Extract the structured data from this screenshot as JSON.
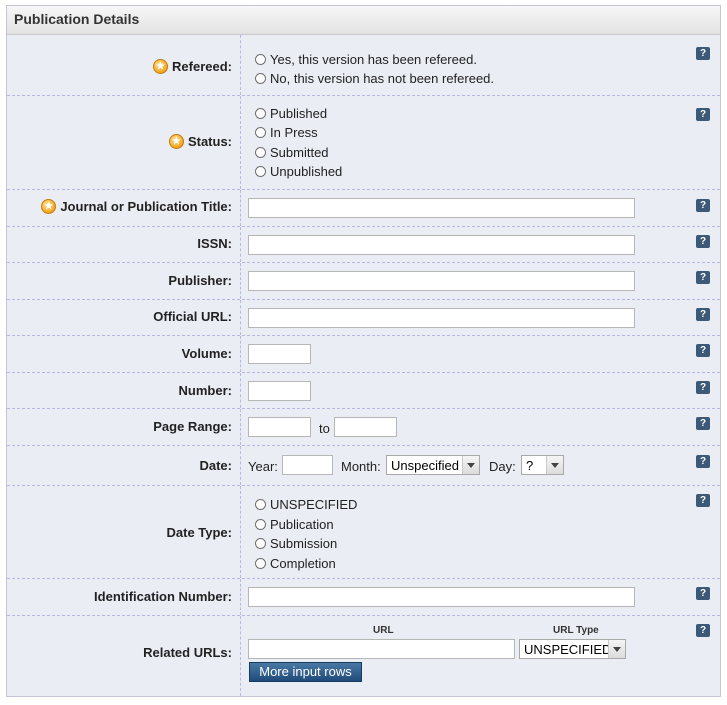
{
  "panel": {
    "title": "Publication Details",
    "help_glyph": "?"
  },
  "refereed": {
    "label": "Refereed:",
    "options": [
      "Yes, this version has been refereed.",
      "No, this version has not been refereed."
    ]
  },
  "status": {
    "label": "Status:",
    "options": [
      "Published",
      "In Press",
      "Submitted",
      "Unpublished"
    ]
  },
  "journal_title": {
    "label": "Journal or Publication Title:",
    "value": ""
  },
  "issn": {
    "label": "ISSN:",
    "value": ""
  },
  "publisher": {
    "label": "Publisher:",
    "value": ""
  },
  "official_url": {
    "label": "Official URL:",
    "value": ""
  },
  "volume": {
    "label": "Volume:",
    "value": ""
  },
  "number": {
    "label": "Number:",
    "value": ""
  },
  "page_range": {
    "label": "Page Range:",
    "separator": "to",
    "from": "",
    "to": ""
  },
  "date": {
    "label": "Date:",
    "year_label": "Year:",
    "month_label": "Month:",
    "month_value": "Unspecified",
    "day_label": "Day:",
    "day_value": "?"
  },
  "date_type": {
    "label": "Date Type:",
    "options": [
      "UNSPECIFIED",
      "Publication",
      "Submission",
      "Completion"
    ]
  },
  "identification_number": {
    "label": "Identification Number:",
    "value": ""
  },
  "related_urls": {
    "label": "Related URLs:",
    "url_header": "URL",
    "type_header": "URL Type",
    "type_value": "UNSPECIFIED",
    "more_rows_label": "More input rows"
  },
  "icons": {
    "required": "star-icon",
    "help": "help-icon"
  }
}
